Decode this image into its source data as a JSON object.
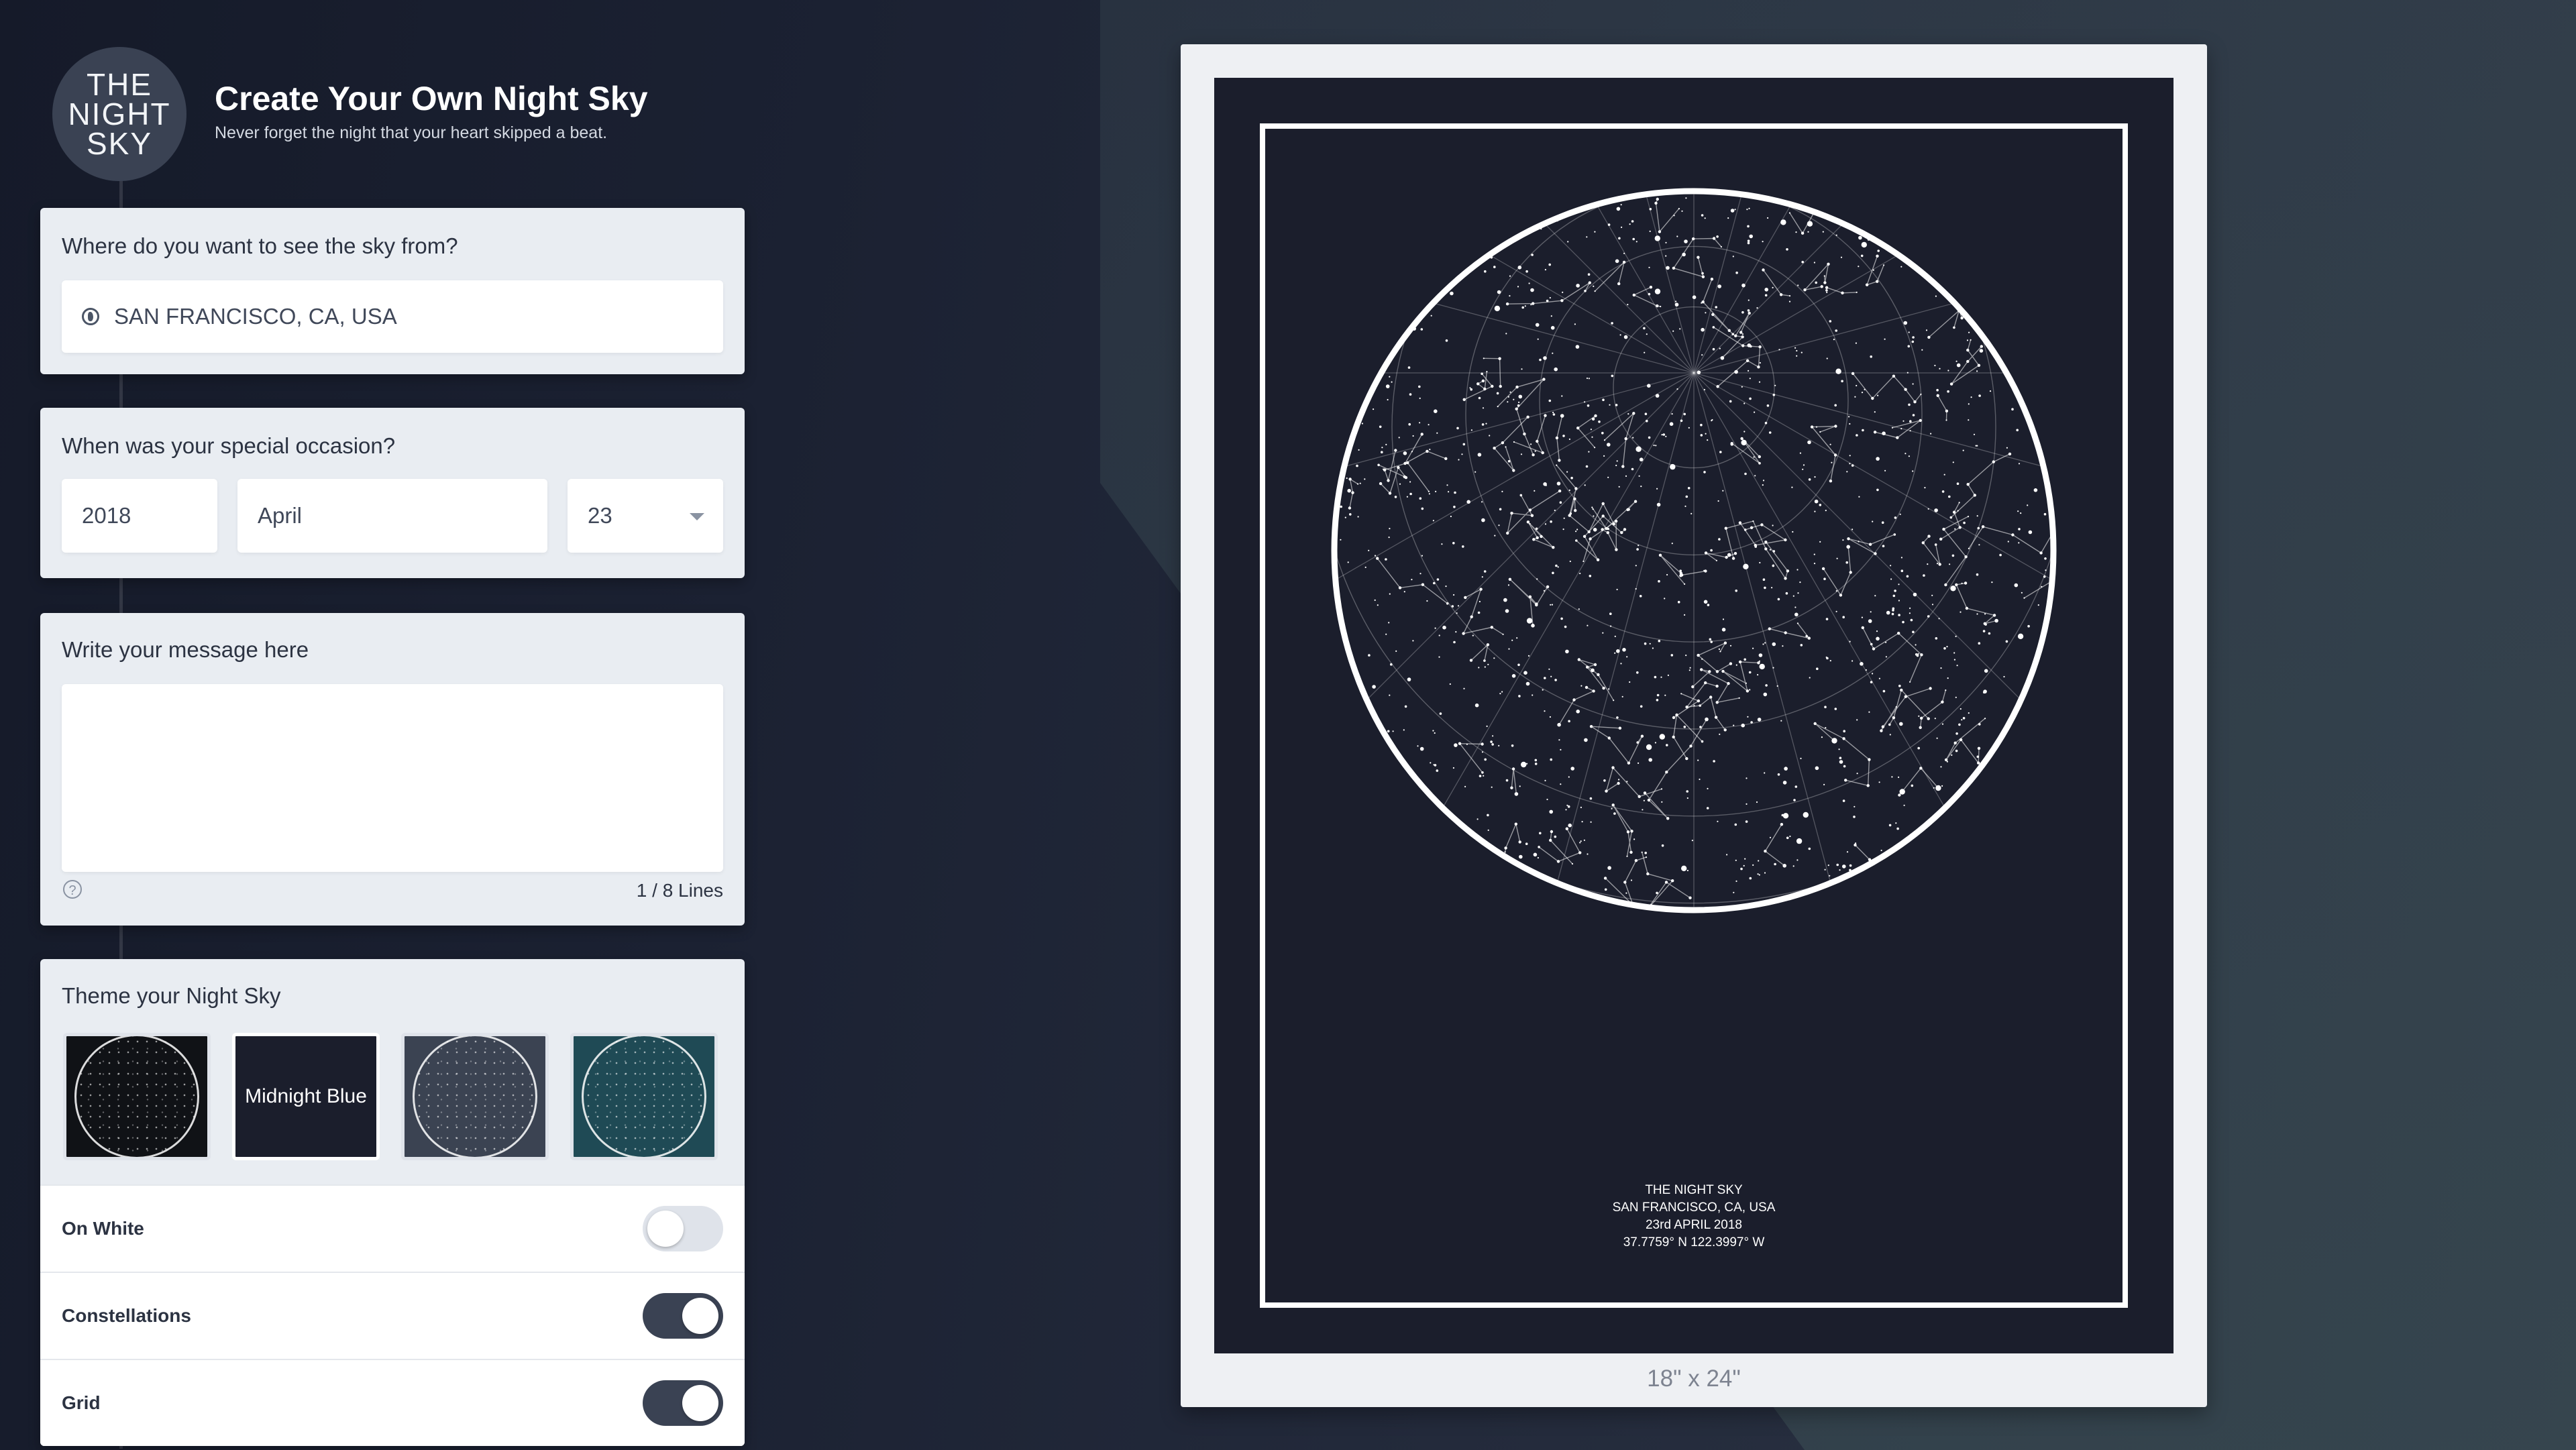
{
  "logo": {
    "line1": "THE",
    "line2": "NIGHT",
    "line3": "SKY"
  },
  "header": {
    "title": "Create Your Own Night Sky",
    "subtitle": "Never forget the night that your heart skipped a beat."
  },
  "location": {
    "label": "Where do you want to see the sky from?",
    "value": "SAN FRANCISCO, CA, USA",
    "icon": "globe-icon"
  },
  "occasion": {
    "label": "When was your special occasion?",
    "year": "2018",
    "month": "April",
    "day": "23"
  },
  "message": {
    "label": "Write your message here",
    "value": "",
    "line_count": "1 / 8 Lines",
    "help_glyph": "?"
  },
  "theme": {
    "label": "Theme your Night Sky",
    "swatches": [
      {
        "label": "",
        "color": "#101216"
      },
      {
        "label": "Midnight Blue",
        "color": "#1b1e2c"
      },
      {
        "label": "",
        "color": "#3b4352"
      },
      {
        "label": "",
        "color": "#1f4a55"
      }
    ],
    "selected_index": 1
  },
  "toggles": [
    {
      "label": "On White",
      "on": false
    },
    {
      "label": "Constellations",
      "on": true
    },
    {
      "label": "Grid",
      "on": true
    }
  ],
  "poster": {
    "caption_line1": "THE NIGHT SKY",
    "caption_line2": "SAN FRANCISCO, CA, USA",
    "caption_line3": "23rd APRIL 2018",
    "caption_line4": "37.7759° N 122.3997° W",
    "size": "18\" x 24\""
  },
  "colors": {
    "toggle_on": "#3a4253",
    "toggle_off": "#dfe3ea"
  }
}
